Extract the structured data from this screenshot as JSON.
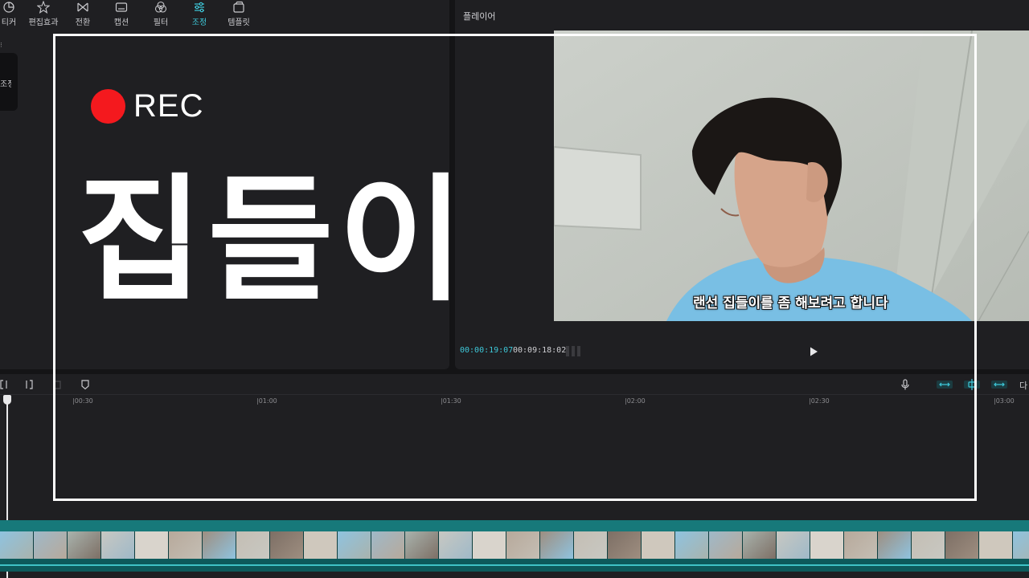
{
  "toolbar": {
    "items": [
      {
        "label": "티커",
        "icon": "sticker-icon"
      },
      {
        "label": "편집효과",
        "icon": "effects-icon"
      },
      {
        "label": "전환",
        "icon": "transition-icon"
      },
      {
        "label": "캡션",
        "icon": "caption-icon"
      },
      {
        "label": "필터",
        "icon": "filter-icon"
      },
      {
        "label": "조정",
        "icon": "adjust-icon",
        "active": true
      },
      {
        "label": "템플릿",
        "icon": "template-icon"
      }
    ]
  },
  "side_tab": {
    "label": "조정"
  },
  "player": {
    "title": "플레이어",
    "current_time": "00:00:19:07",
    "total_time": "00:09:18:02"
  },
  "video": {
    "subtitle": "랜선 집들이를 좀 해보려고 합니다"
  },
  "overlay": {
    "rec_label": "REC",
    "title": "집들이"
  },
  "timeline": {
    "ruler_labels": [
      "|00:30",
      "|01:00",
      "|01:30",
      "|02:00",
      "|02:30",
      "|03:00"
    ],
    "right_label": "다"
  },
  "colors": {
    "accent": "#3ec8d9",
    "panel_bg": "#1f1f22",
    "rec_red": "#f4191e",
    "track_teal": "#17797a"
  }
}
